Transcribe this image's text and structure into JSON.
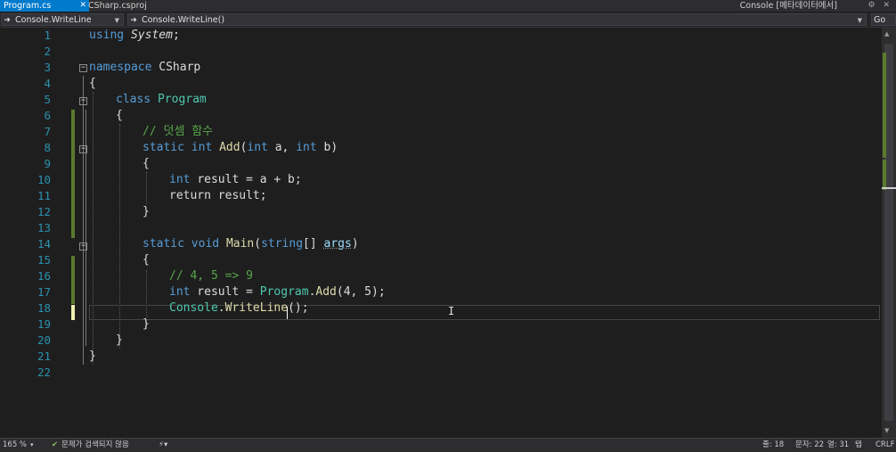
{
  "tabs": {
    "active_label": "Program.cs",
    "active_close": "✕",
    "csproj_label": "CSharp.csproj",
    "console_label": "Console [메타데이터에서]",
    "right_icons": "⚙ ✕"
  },
  "navbar": {
    "left_icon": "➜",
    "left_label": "Console.WriteLine",
    "mid_icon": "➜",
    "mid_label": "Console.WriteLine()",
    "right_label": "Go"
  },
  "line_numbers": [
    "1",
    "2",
    "3",
    "4",
    "5",
    "6",
    "7",
    "8",
    "9",
    "10",
    "11",
    "12",
    "13",
    "14",
    "15",
    "16",
    "17",
    "18",
    "19",
    "20",
    "21",
    "22"
  ],
  "code": {
    "l1": {
      "kw": "using",
      "ns": "System",
      "end": ";"
    },
    "l3": {
      "kw": "namespace",
      "name": "CSharp"
    },
    "l4": {
      "brace": "{"
    },
    "l5": {
      "kw": "class",
      "name": "Program"
    },
    "l6": {
      "brace": "{"
    },
    "l7": {
      "comment": "// 덧셈 함수"
    },
    "l8": {
      "kw1": "static",
      "kw2": "int",
      "fn": "Add",
      "p1": "(",
      "kw3": "int",
      "a": " a, ",
      "kw4": "int",
      "b": " b)"
    },
    "l9": {
      "brace": "{"
    },
    "l10": {
      "kw": "int",
      "rest": "result = a + b;"
    },
    "l11": {
      "rest": "return result;"
    },
    "l12": {
      "brace": "}"
    },
    "l14": {
      "kw1": "static",
      "kw2": "void",
      "fn": "Main",
      "p1": "(",
      "kw3": "string",
      "rest": "[] ",
      "args": "args",
      "end": ")"
    },
    "l15": {
      "brace": "{"
    },
    "l16": {
      "comment": "// 4, 5 => 9"
    },
    "l17": {
      "kw": "int",
      "rest1": " result = ",
      "cls": "Program",
      "dot": ".",
      "fn": "Add",
      "rest2": "(4, 5);"
    },
    "l18": {
      "cls": "Console",
      "dot": ".",
      "fn": "WriteLine",
      "rest": "();"
    },
    "l19": {
      "brace": "}"
    },
    "l20": {
      "brace": "}"
    },
    "l21": {
      "brace": "}"
    }
  },
  "status": {
    "zoom": "165 %",
    "zoom_arrow": "▾",
    "issues": "문제가 검색되지 않음",
    "branch": "⚡▾",
    "line": "줄: 18",
    "char": "문자: 22",
    "col": "열: 31",
    "mode": "탭",
    "eol": "CRLF"
  },
  "colors": {
    "keyword": "#569cd6",
    "type": "#4ec9b0",
    "method": "#dcdcaa",
    "comment": "#57a64a",
    "line_number": "#2b91af",
    "tab_active": "#007acc"
  }
}
